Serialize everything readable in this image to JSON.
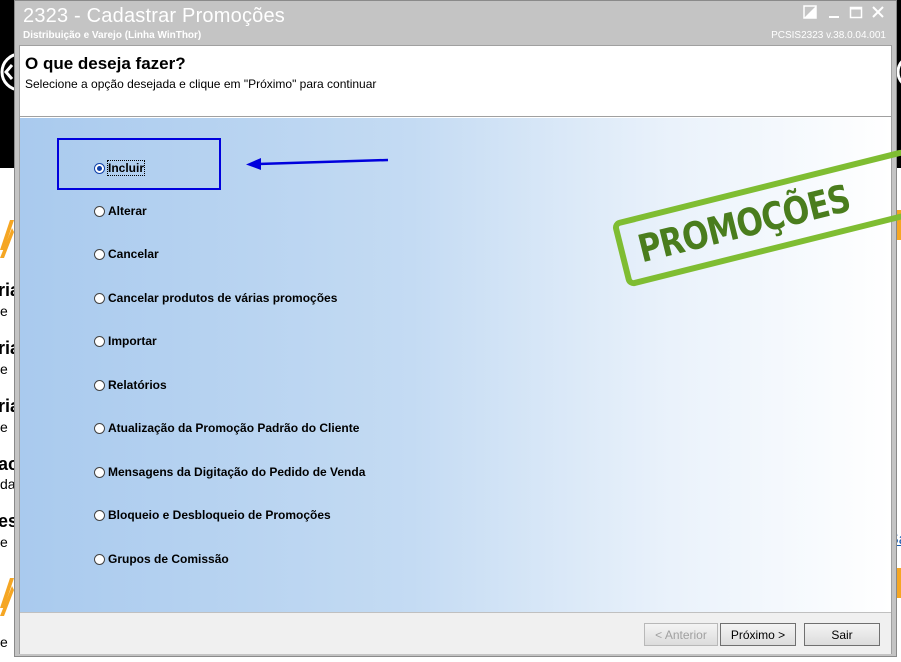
{
  "window": {
    "title": "2323 - Cadastrar Promoções",
    "subtitle": "Distribuição e Varejo (Linha WinThor)",
    "version": "PCSIS2323  v.38.0.04.001"
  },
  "header": {
    "heading": "O que deseja fazer?",
    "instructions": "Selecione a opção desejada e clique em \"Próximo\" para continuar"
  },
  "options": [
    {
      "label": "Incluir",
      "selected": true
    },
    {
      "label": "Alterar",
      "selected": false
    },
    {
      "label": "Cancelar",
      "selected": false
    },
    {
      "label": "Cancelar produtos de várias promoções",
      "selected": false
    },
    {
      "label": "Importar",
      "selected": false
    },
    {
      "label": "Relatórios",
      "selected": false
    },
    {
      "label": "Atualização da Promoção Padrão do Cliente",
      "selected": false
    },
    {
      "label": "Mensagens da Digitação do Pedido de Venda",
      "selected": false
    },
    {
      "label": "Bloqueio e Desbloqueio de Promoções",
      "selected": false
    },
    {
      "label": "Grupos de Comissão",
      "selected": false
    }
  ],
  "stamp": {
    "text": "PROMOÇÕES"
  },
  "footer": {
    "prev_label": "< Anterior",
    "next_label": "Próximo >",
    "exit_label": "Sair"
  },
  "background": {
    "fragments": [
      "ria",
      "e",
      "ria",
      "e",
      "ria",
      "e",
      "ac",
      "da",
      "es",
      "e",
      "e"
    ],
    "link": "Sa"
  },
  "colors": {
    "titlebar": "#c4c4c4",
    "annotation": "#0000dd",
    "stamp_border": "#7fbd32",
    "stamp_text": "#4a7d1d",
    "background_accent": "#f5a623"
  }
}
